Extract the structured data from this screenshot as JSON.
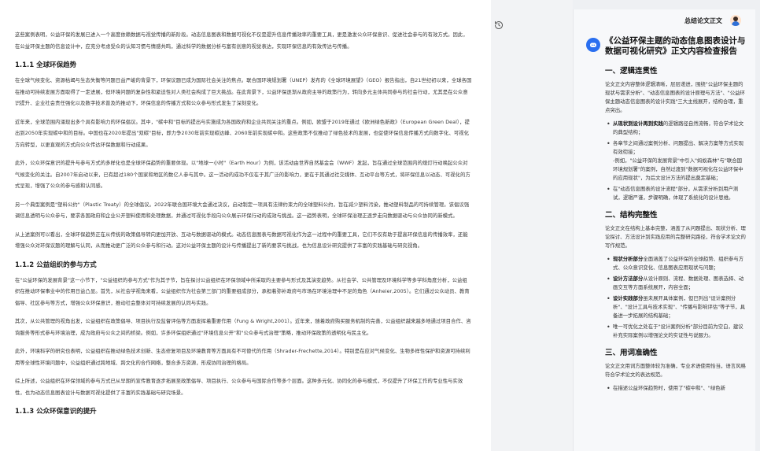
{
  "document": {
    "p1": "这些案例表明，公益环保的发展已进入一个高度依赖数据与视觉传播的新阶段。动态信息图表和数据可视化不仅是提升信息传播效率的重要工具，更是激发公众环保意识、促进社会参与的有效方式。因此，在公益环保主题的信息设计中，应充分考虑受众的认知习惯与情感共鸣，通过科学的数据分析与富有创意的视觉表达，实现环保信息的有效传达与传播。",
    "h_1_1_1": "1.1.1 全球环保趋势",
    "p2": "在全球气候变化、资源枯竭与生态失衡等问题日益严峻的背景下，环保议题已成为国际社会关注的焦点。联合国环境规划署（UNEP）发布的《全球环境展望》（GEO）报告指出，自21世纪初以来，全球各国在推动可持续发展方面取得了一定进展，但环境问题的复杂性和紧迫性对人类社会构成了巨大挑战。在此背景下，公益环保逐渐从政府主导的政策行为，转向多元主体共同参与的社会行动，尤其是在公众意识提升、企业社会责任强化以及数字技术普及的推动下，环保信息的传播方式和公众参与形式发生了深刻变化。",
    "p3": "近年来，全球范围内涌现出多个具有影响力的环保倡议。其中，\"碳中和\"目标的提出与实施成为各国政府和企业共同关注的重点。例如，欧盟于2019年通过《欧洲绿色新政》（European Green Deal），提出到2050年实现碳中和的目标。中国也在2020年提出\"双碳\"目标，即力争2030年前实现碳达峰、2060年前实现碳中和。这些政策不仅推动了绿色技术的发展，也促使环保信息传播方式向数字化、可视化方向转型，以更直观的方式向公众传达环保数据和行动成果。",
    "p4": "此外，公众环保意识的提升与参与方式的多样化也是全球环保趋势的重要体现。以\"地球一小时\"（Earth Hour）为例，该活动由世界自然基金会（WWF）发起，旨在通过全球范围内的熄灯行动唤起公众对气候变化的关注。自2007年启动以来，已有超过180个国家和地区的数亿人参与其中。这一活动的成功不仅在于其广泛的影响力，更在于其通过社交媒体、互动平台等方式，将环保信息以动态、可视化的方式呈现，增强了公众的参与感和认同感。",
    "p5": "另一个典型案例是\"塑料公约\"（Plastic Treaty）的全球倡议。2022年联合国环境大会通过决议，启动制定一项具有法律约束力的全球塑料公约，旨在减少塑料污染，推动塑料制品的可持续管理。该倡议强调信息透明与公众参与，要求各国政府和企业公开塑料使用和处理数据，并通过可视化手段向公众展示环保行动的成效与挑战。这一趋势表明，全球环保治理正逐步走向数据驱动与公众协同的新模式。",
    "p6": "从上述案例可以看出，全球环保趋势正在从传统的政策倡导转向更加开放、互动与数据驱动的模式。动态信息图表与数据可视化作为这一过程中的重要工具，它们不仅有助于提高环保信息的传播效率，还能增强公众对环保议题的理解与认同，从而推动更广泛的公众参与和行动。这对公益环保主题的设计与传播提出了新的要求与挑战，也为信息设计研究提供了丰富的实践基础与研究视角。",
    "h_1_1_2": "1.1.2 公益组织的参与方式",
    "p7": "在\"公益环保的发展背景\"这一小节下，\"公益组织的参与方式\"作为其子节，旨在探讨公益组织在环保领域中所采取的主要参与形式及其演变趋势。从社会学、公共管理及环境科学等多学科角度分析，公益组织在推动环保事业中的作用日益凸显。首先，从社会学视角来看，公益组织作为社会第三部门的重要组成部分，承担着弥补政府与市场在环境治理中不足的角色（Anheier,2005）。它们通过公众动员、教育倡导、社区参与等方式，增强公众环保意识，推动社会整体对可持续发展的认同与实践。",
    "p8": "其次，从公共管理的视角出发，公益组织在政策倡导、项目执行及监督评估等方面发挥着重要作用（Fung & Wright,2001）。近年来，随着政府购买服务机制的完善，公益组织越来越多地通过项目合作、咨询服务等形式参与环境治理，成为政府与公众之间的桥梁。例如，许多环保组织通过\"环境信息公开\"和\"公众参与式治理\"策略，推动环保政策的透明化与民主化。",
    "p9": "此外，环境科学的研究也表明，公益组织在推动绿色技术创新、生态修复项目及环境教育等方面具有不可替代的作用（Shrader-Frechette,2014）。特别是在应对气候变化、生物多样性保护和资源可持续利用等全球性环境问题中，公益组织通过跨地域、跨文化的合作网络，整合多方资源，形成协同治理的格局。",
    "p10": "综上所述，公益组织在环保领域的参与方式已从早期的宣传教育逐步拓展至政策倡导、项目执行、公众参与与国际合作等多个层面。这种多元化、协同化的参与模式，不仅提升了环保工作的专业性与实效性，也为动态信息图表设计与数据可视化提供了丰富的实践基础与研究场景。",
    "h_1_1_3": "1.1.3 公众环保意识的提升"
  },
  "panel": {
    "header_title": "总结论文正文",
    "main_title": "《公益环保主题的动态信息图表设计与数据可视化研究》正文内容检查报告",
    "s1_title": "一、逻辑连贯性",
    "s1_body": "论文正文内容整体逻辑清晰，层层递进，围绕\"公益环保主题的现状与需求分析\"、\"动态信息图表的设计原理与方法\"、\"公益环保主题动态信息图表的设计实践\"三大主线展开，结构合理，重点突出。",
    "s1_b1_bold": "从现状到设计再到实践",
    "s1_b1_rest": "的逻辑路径自然流畅，符合学术论文的典型结构；",
    "s1_b2": "各章节之间通过案例分析、问题提出、解决方案等方式实现有效衔接；",
    "s1_b2_extra": "-例如，\"公益环保的发展背景\"中引入\"蚂蚁森林\"与\"联合国环境规划署\"的案例，自然过渡到\"数据可视化在公益环保中的应用现状\"，为后文设计方法的提出奠定基础；",
    "s1_b3": "在\"动态信息图表的设计流程\"部分，从需求分析到用户测试，逻辑严谨，步骤明确，体现了系统化的设计思维。",
    "s2_title": "二、结构完整性",
    "s2_body": "论文正文在结构上基本完整，涵盖了从问题提出、现状分析、理论探讨、方法设计到实践应用的完整研究路径，符合学术论文的写作规范。",
    "s2_b1_bold": "现状分析部分",
    "s2_b1_rest": "全面涵盖了公益环保的全球趋势、组织参与方式、公众意识变化、信息图表应用现状与问题；",
    "s2_b2_bold": "设计方法部分",
    "s2_b2_rest": "从设计原则、流程、数据处理、图表选择、动画交互等方面系统展开，内容全面；",
    "s2_b3_bold": "设计实践部分",
    "s2_b3_rest": "虽未展开具体案例，但已列出\"设计案例分析\"、\"设计工具与技术实现\"、\"传播与影响评估\"等子节，具备进一步拓展的结构基础；",
    "s2_b4": "唯一可优化之处在于\"设计案例分析\"部分目前为空白，建议补充实际案例以增强论文的实证性与说服力。",
    "s3_title": "三、用词准确性",
    "s3_body": "论文正文用词方面整体较为准确，专业术语使用恰当，语言风格符合学术论文的表达规范。",
    "s3_b1": "在描述公益环保趋势时，使用了\"碳中和\"、\"绿色新"
  }
}
